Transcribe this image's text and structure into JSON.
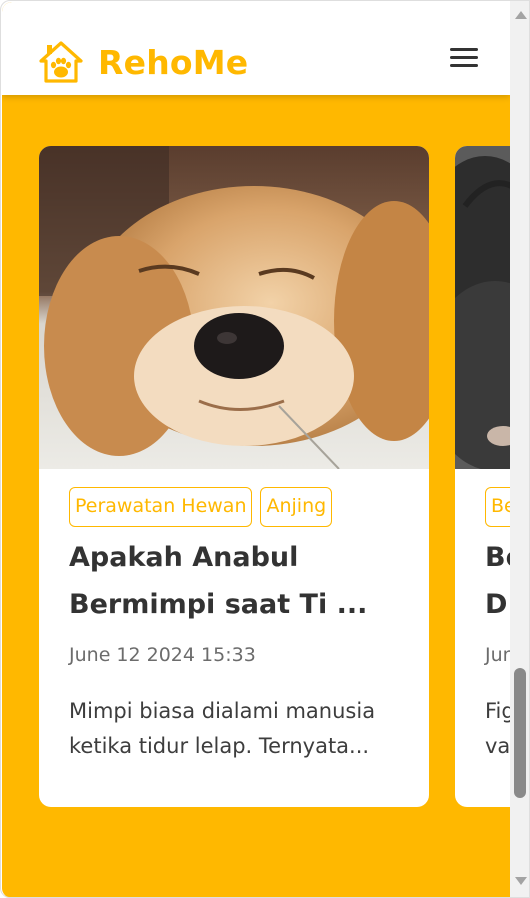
{
  "brand": {
    "name": "RehoMe",
    "logo_icon": "house-paw-icon",
    "color": "#ffb800"
  },
  "navbar": {
    "menu_icon": "hamburger-menu-icon"
  },
  "colors": {
    "accent": "#ffb800",
    "text_dark": "#333333",
    "text_muted": "#6c6c6c",
    "card_bg": "#ffffff"
  },
  "cards": [
    {
      "image_subject": "golden retriever sleeping on floor",
      "tags": [
        "Perawatan Hewan",
        "Anjing"
      ],
      "title_line1": "Apakah Anabul",
      "title_line2": "Bermimpi saat Ti ...",
      "date": "June 12 2024 15:33",
      "excerpt_line1": "Mimpi biasa dialami manusia",
      "excerpt_line2": "ketika tidur lelap. Ternyata..."
    },
    {
      "image_subject": "black puppy",
      "tags": [
        "Be"
      ],
      "title_line1": "Be",
      "title_line2": "D",
      "date": "Jun",
      "excerpt_line1": "Fig",
      "excerpt_line2": "va"
    }
  ],
  "scrollbar": {
    "up_icon": "scroll-up-arrow-icon",
    "down_icon": "scroll-down-arrow-icon"
  }
}
